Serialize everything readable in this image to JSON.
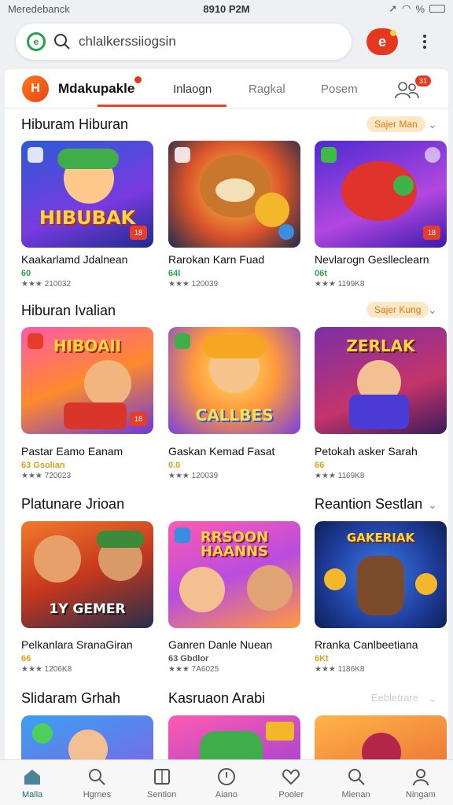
{
  "status": {
    "carrier": "Meredebanck",
    "time": "8910 P2M",
    "battery": "%"
  },
  "search": {
    "text": "chlalkerssiiogsin"
  },
  "appbar": {
    "brand": "Mdakupakle",
    "tabs": [
      "Inlaogn",
      "Ragkal",
      "Posem"
    ],
    "people_badge": "31"
  },
  "sections": [
    {
      "title": "Hiburam Hiburan",
      "action": "Sajer Man",
      "cards": [
        {
          "name": "Kaakarlamd Jdalnean",
          "price": "60",
          "rating": "★★★ 210032",
          "art": "HIBUBAK"
        },
        {
          "name": "Rarokan Karn Fuad",
          "price": "64l",
          "rating": "★★★ 120039",
          "art": ""
        },
        {
          "name": "Nevlarogn Geslleclearn",
          "price": "06t",
          "rating": "★★★ 1199K8",
          "art": ""
        }
      ]
    },
    {
      "title": "Hiburan Ivalian",
      "action": "Sajer Kung",
      "cards": [
        {
          "name": "Pastar Eamo Eanam",
          "price": "63 Gsolian",
          "rating": "★★★ 720023",
          "art": "HIBOAII"
        },
        {
          "name": "Gaskan Kemad Fasat",
          "price": "0.0",
          "rating": "★★★ 120039",
          "art": "CALLBES"
        },
        {
          "name": "Petokah asker Sarah",
          "price": "66",
          "rating": "★★★ 1169K8",
          "art": "ZERLAK"
        }
      ]
    },
    {
      "title": "Platunare Jrioan",
      "title_right": "Reantion Sestlan",
      "cards": [
        {
          "name": "Pelkanlara SranaGiran",
          "price": "66",
          "rating": "★★★ 1206K8",
          "art": "1Y GEMER"
        },
        {
          "name": "Ganren Danle Nuean",
          "price": "63 Gbdlor",
          "rating": "★★★ 7A6025",
          "art": "RRSOON HAANNS"
        },
        {
          "name": "Rranka Canlbeetiana",
          "price": "6Kt",
          "rating": "★★★ 1186K8",
          "art": "GAKERIAK"
        }
      ]
    },
    {
      "title": "Slidaram Grhah",
      "title_right": "Kasruaon Arabi",
      "action": "Eebletrare"
    }
  ],
  "nav": [
    "Malla",
    "Hgrnes",
    "Sention",
    "Aiano",
    "Pooler",
    "Mienan",
    "Ningam"
  ]
}
